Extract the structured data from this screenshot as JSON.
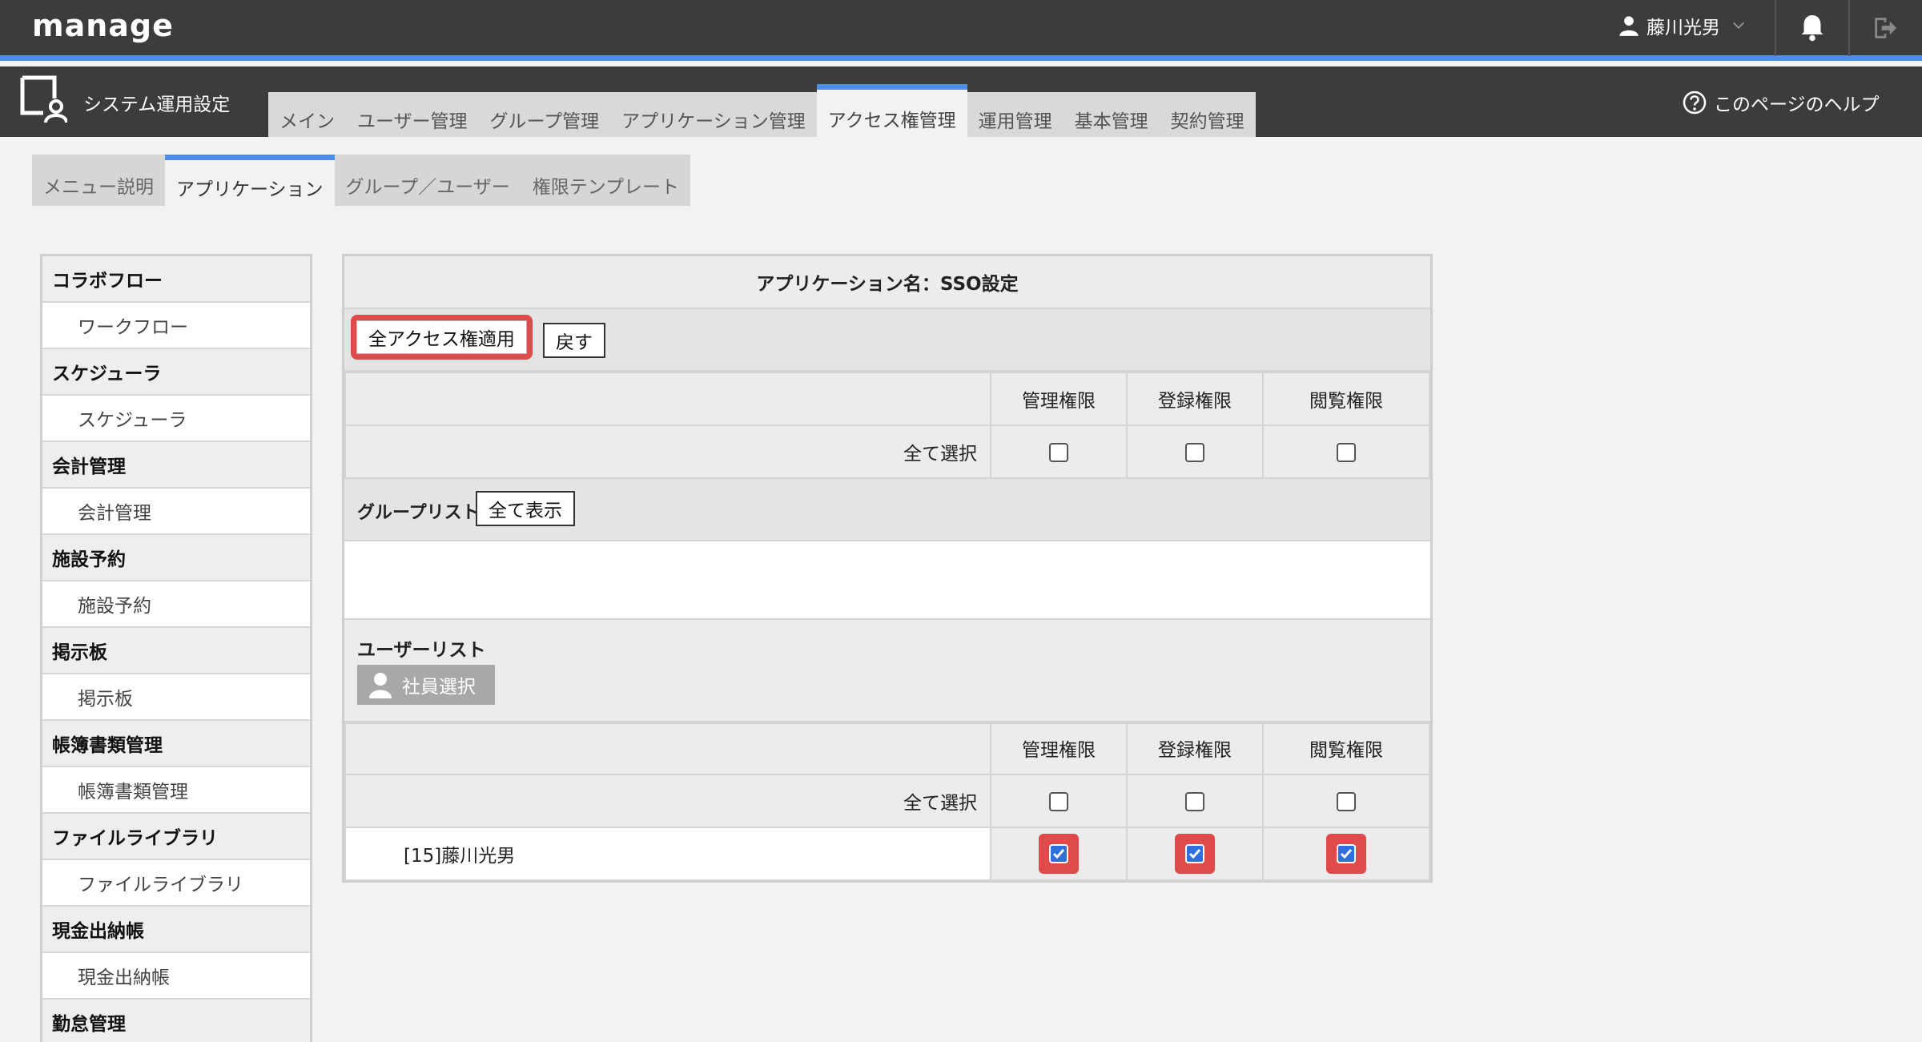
{
  "header": {
    "logo": "manage",
    "user_name": "藤川光男"
  },
  "secondary_bar": {
    "title": "システム運用設定",
    "help": "このページのヘルプ",
    "tabs": [
      {
        "label": "メイン"
      },
      {
        "label": "ユーザー管理"
      },
      {
        "label": "グループ管理"
      },
      {
        "label": "アプリケーション管理"
      },
      {
        "label": "アクセス権管理",
        "active": true
      },
      {
        "label": "運用管理"
      },
      {
        "label": "基本管理"
      },
      {
        "label": "契約管理"
      }
    ]
  },
  "sub_tabs": [
    {
      "label": "メニュー説明"
    },
    {
      "label": "アプリケーション",
      "active": true
    },
    {
      "label": "グループ／ユーザー"
    },
    {
      "label": "権限テンプレート"
    }
  ],
  "left_menu": [
    {
      "category": "コラボフロー",
      "item": "ワークフロー"
    },
    {
      "category": "スケジューラ",
      "item": "スケジューラ"
    },
    {
      "category": "会計管理",
      "item": "会計管理"
    },
    {
      "category": "施設予約",
      "item": "施設予約"
    },
    {
      "category": "掲示板",
      "item": "掲示板"
    },
    {
      "category": "帳簿書類管理",
      "item": "帳簿書類管理"
    },
    {
      "category": "ファイルライブラリ",
      "item": "ファイルライブラリ"
    },
    {
      "category": "現金出納帳",
      "item": "現金出納帳"
    },
    {
      "category": "勤怠管理",
      "item": ""
    }
  ],
  "panel": {
    "app_name": "アプリケーション名：SSO設定",
    "apply_all_button": "全アクセス権適用",
    "back_button": "戻す",
    "col_admin": "管理権限",
    "col_register": "登録権限",
    "col_view": "閲覧権限",
    "select_all": "全て選択",
    "group_list_label": "グループリスト",
    "show_all_button": "全て表示",
    "user_list_label": "ユーザーリスト",
    "employee_select_button": "社員選択",
    "user_row": {
      "name": "[15]藤川光男",
      "admin_checked": true,
      "register_checked": true,
      "view_checked": true
    }
  },
  "colors": {
    "accent_blue": "#4a8ee8",
    "highlight_red": "#e14a4a",
    "header_dark": "#3c3c3c"
  }
}
